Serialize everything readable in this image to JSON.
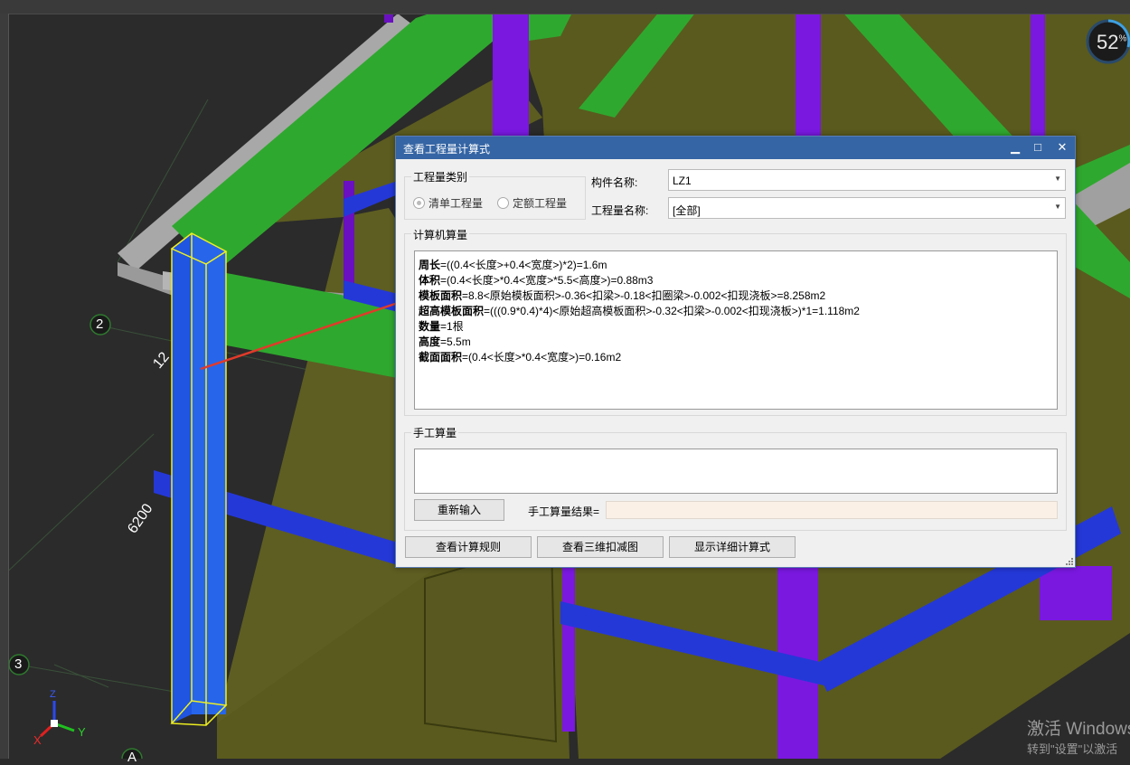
{
  "viewport": {
    "zoom_percent": "52",
    "zoom_unit": "%",
    "grid_labels": [
      "2",
      "3",
      "A"
    ],
    "dimension_labels": [
      "12",
      "6200"
    ],
    "axes": {
      "x": "X",
      "y": "Y",
      "z": "Z"
    }
  },
  "watermark": {
    "line1": "激活 Windows",
    "line2": "转到\"设置\"以激活"
  },
  "dialog": {
    "title": "查看工程量计算式",
    "window_buttons": {
      "minimize": "▁",
      "maximize": "□",
      "close": "✕"
    },
    "quantity_type": {
      "label": "工程量类别",
      "options": [
        {
          "label": "清单工程量",
          "selected": true
        },
        {
          "label": "定额工程量",
          "selected": false
        }
      ]
    },
    "component_name": {
      "label": "构件名称:",
      "value": "LZ1"
    },
    "quantity_name": {
      "label": "工程量名称:",
      "value": "[全部]"
    },
    "computer_calc": {
      "label": "计算机算量",
      "lines": [
        {
          "key": "周长",
          "expr": "=((0.4<长度>+0.4<宽度>)*2)=1.6m"
        },
        {
          "key": "体积",
          "expr": "=(0.4<长度>*0.4<宽度>*5.5<高度>)=0.88m3"
        },
        {
          "key": "模板面积",
          "expr": "=8.8<原始模板面积>-0.36<扣梁>-0.18<扣圈梁>-0.002<扣现浇板>=8.258m2"
        },
        {
          "key": "超高模板面积",
          "expr": "=(((0.9*0.4)*4)<原始超高模板面积>-0.32<扣梁>-0.002<扣现浇板>)*1=1.118m2"
        },
        {
          "key": "数量",
          "expr": "=1根"
        },
        {
          "key": "高度",
          "expr": "=5.5m"
        },
        {
          "key": "截面面积",
          "expr": "=(0.4<长度>*0.4<宽度>)=0.16m2"
        }
      ]
    },
    "manual_calc": {
      "label": "手工算量",
      "value": "",
      "reinput_button": "重新输入",
      "result_label": "手工算量结果=",
      "result_value": ""
    },
    "buttons": {
      "view_rules": "查看计算规则",
      "view_3d": "查看三维扣减图",
      "show_detail": "显示详细计算式"
    }
  },
  "colors": {
    "title_bar": "#3565a4",
    "green_beam": "#2fa82f",
    "blue_beam": "#2438d8",
    "purple_column": "#7a18e0",
    "olive_wall": "#5a5a1e",
    "selected_column": "#1f55e0",
    "selection_outline": "#f0f020",
    "arrow": "#e23a2a"
  }
}
